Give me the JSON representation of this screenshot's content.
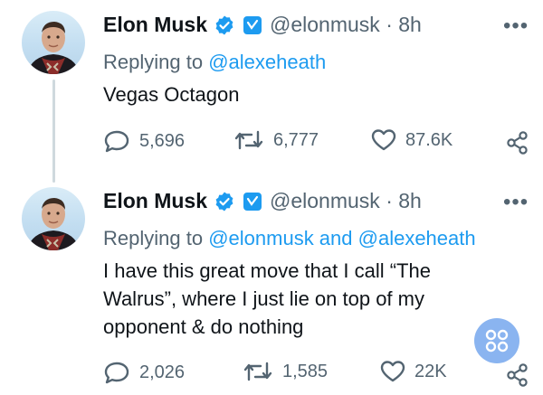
{
  "tweets": [
    {
      "name": "Elon Musk",
      "handle": "@elonmusk",
      "separator": "·",
      "time": "8h",
      "replying_prefix": "Replying to",
      "replying_to": "@alexeheath",
      "text": "Vegas Octagon",
      "replies": "5,696",
      "retweets": "6,777",
      "likes": "87.6K"
    },
    {
      "name": "Elon Musk",
      "handle": "@elonmusk",
      "separator": "·",
      "time": "8h",
      "replying_prefix": "Replying to",
      "replying_to": "@elonmusk and @alexeheath",
      "text": "I have this great move that I call “The Walrus”, where I just lie on top of my opponent & do nothing",
      "replies": "2,026",
      "retweets": "1,585",
      "likes": "22K"
    }
  ],
  "more_glyph": "•••",
  "colors": {
    "accent": "#1d9bf0",
    "muted": "#536471",
    "text": "#0f1419",
    "fab": "#8ab4f0"
  }
}
